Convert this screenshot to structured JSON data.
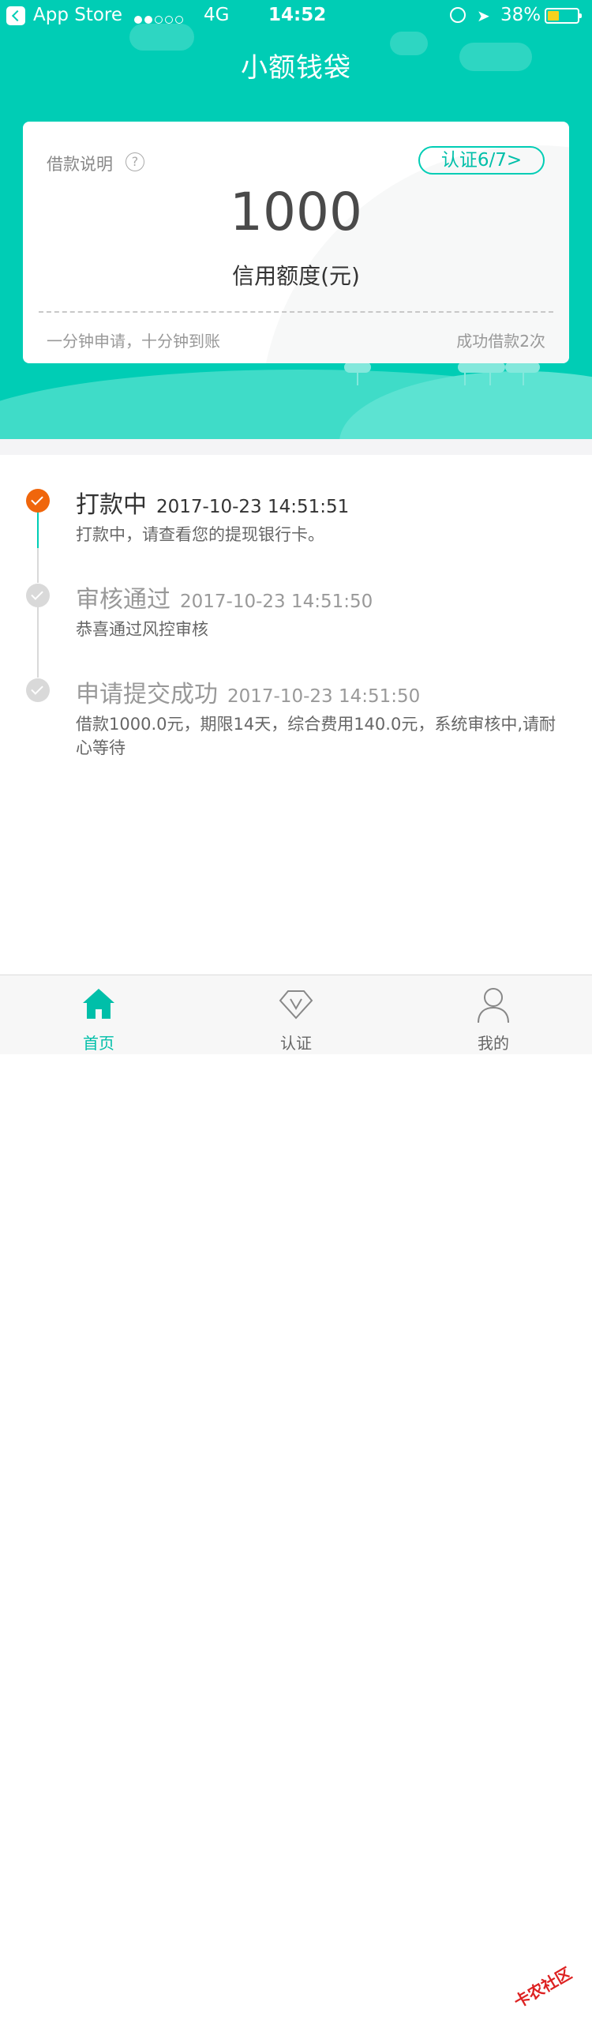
{
  "status_bar": {
    "back_app": "App Store",
    "network": "4G",
    "time": "14:52",
    "battery": "38%",
    "battery_level": 0.38
  },
  "page_title": "小额钱袋",
  "card": {
    "label": "借款说明",
    "help_icon": "question-icon",
    "auth_button": "认证6/7>",
    "amount": "1000",
    "amount_label": "信用额度(元)",
    "note_left": "一分钟申请，十分钟到账",
    "note_right": "成功借款2次"
  },
  "timeline": [
    {
      "title": "打款中",
      "time": "2017-10-23 14:51:51",
      "desc": "打款中，请查看您的提现银行卡。",
      "status": "active"
    },
    {
      "title": "审核通过",
      "time": "2017-10-23 14:51:50",
      "desc": "恭喜通过风控审核",
      "status": "done"
    },
    {
      "title": "申请提交成功",
      "time": "2017-10-23 14:51:50",
      "desc": "借款1000.0元，期限14天，综合费用140.0元，系统审核中,请耐心等待",
      "status": "done"
    }
  ],
  "tabs": [
    {
      "label": "首页",
      "icon": "home-icon",
      "active": true
    },
    {
      "label": "认证",
      "icon": "diamond-v-icon",
      "active": false
    },
    {
      "label": "我的",
      "icon": "user-icon",
      "active": false
    }
  ],
  "watermark": "卡农社区",
  "colors": {
    "primary": "#00CDB5",
    "active_dot": "#F0660C",
    "inactive_dot": "#D9D9D9",
    "tab_active": "#00BFA9",
    "tab_inactive": "#888888"
  }
}
